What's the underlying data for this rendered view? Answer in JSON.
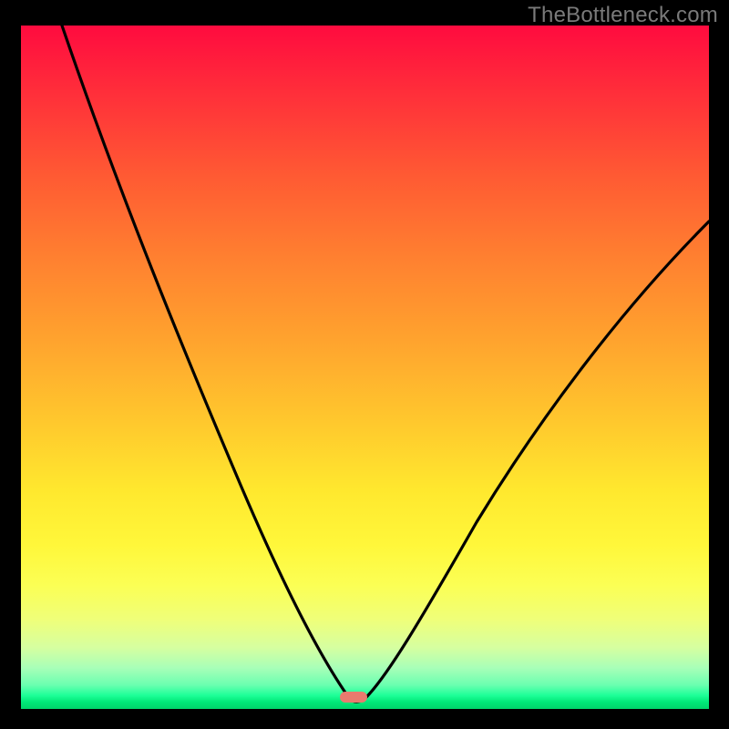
{
  "watermark": "TheBottleneck.com",
  "colors": {
    "frame": "#000000",
    "curve": "#000000",
    "marker": "#e97a6e",
    "gradient_top": "#ff0b3f",
    "gradient_bottom": "#00d36a"
  },
  "chart_data": {
    "type": "line",
    "title": "",
    "xlabel": "",
    "ylabel": "",
    "xlim": [
      0,
      100
    ],
    "ylim": [
      0,
      100
    ],
    "grid": false,
    "legend": false,
    "annotations": [
      {
        "text": "TheBottleneck.com",
        "x": 99,
        "y": 100,
        "anchor": "top-right"
      }
    ],
    "series": [
      {
        "name": "bottleneck-curve",
        "x": [
          0,
          5,
          10,
          15,
          20,
          25,
          30,
          35,
          40,
          45,
          47,
          48,
          49,
          50,
          52,
          55,
          60,
          65,
          70,
          75,
          80,
          85,
          90,
          95,
          100
        ],
        "values": [
          100,
          90,
          79,
          68,
          58,
          47,
          39,
          30,
          20,
          8,
          3,
          1.5,
          1,
          1.2,
          3,
          8,
          17,
          26,
          34,
          42,
          49,
          56,
          62,
          67,
          71
        ]
      }
    ],
    "marker": {
      "x": 48,
      "y": 1
    }
  }
}
